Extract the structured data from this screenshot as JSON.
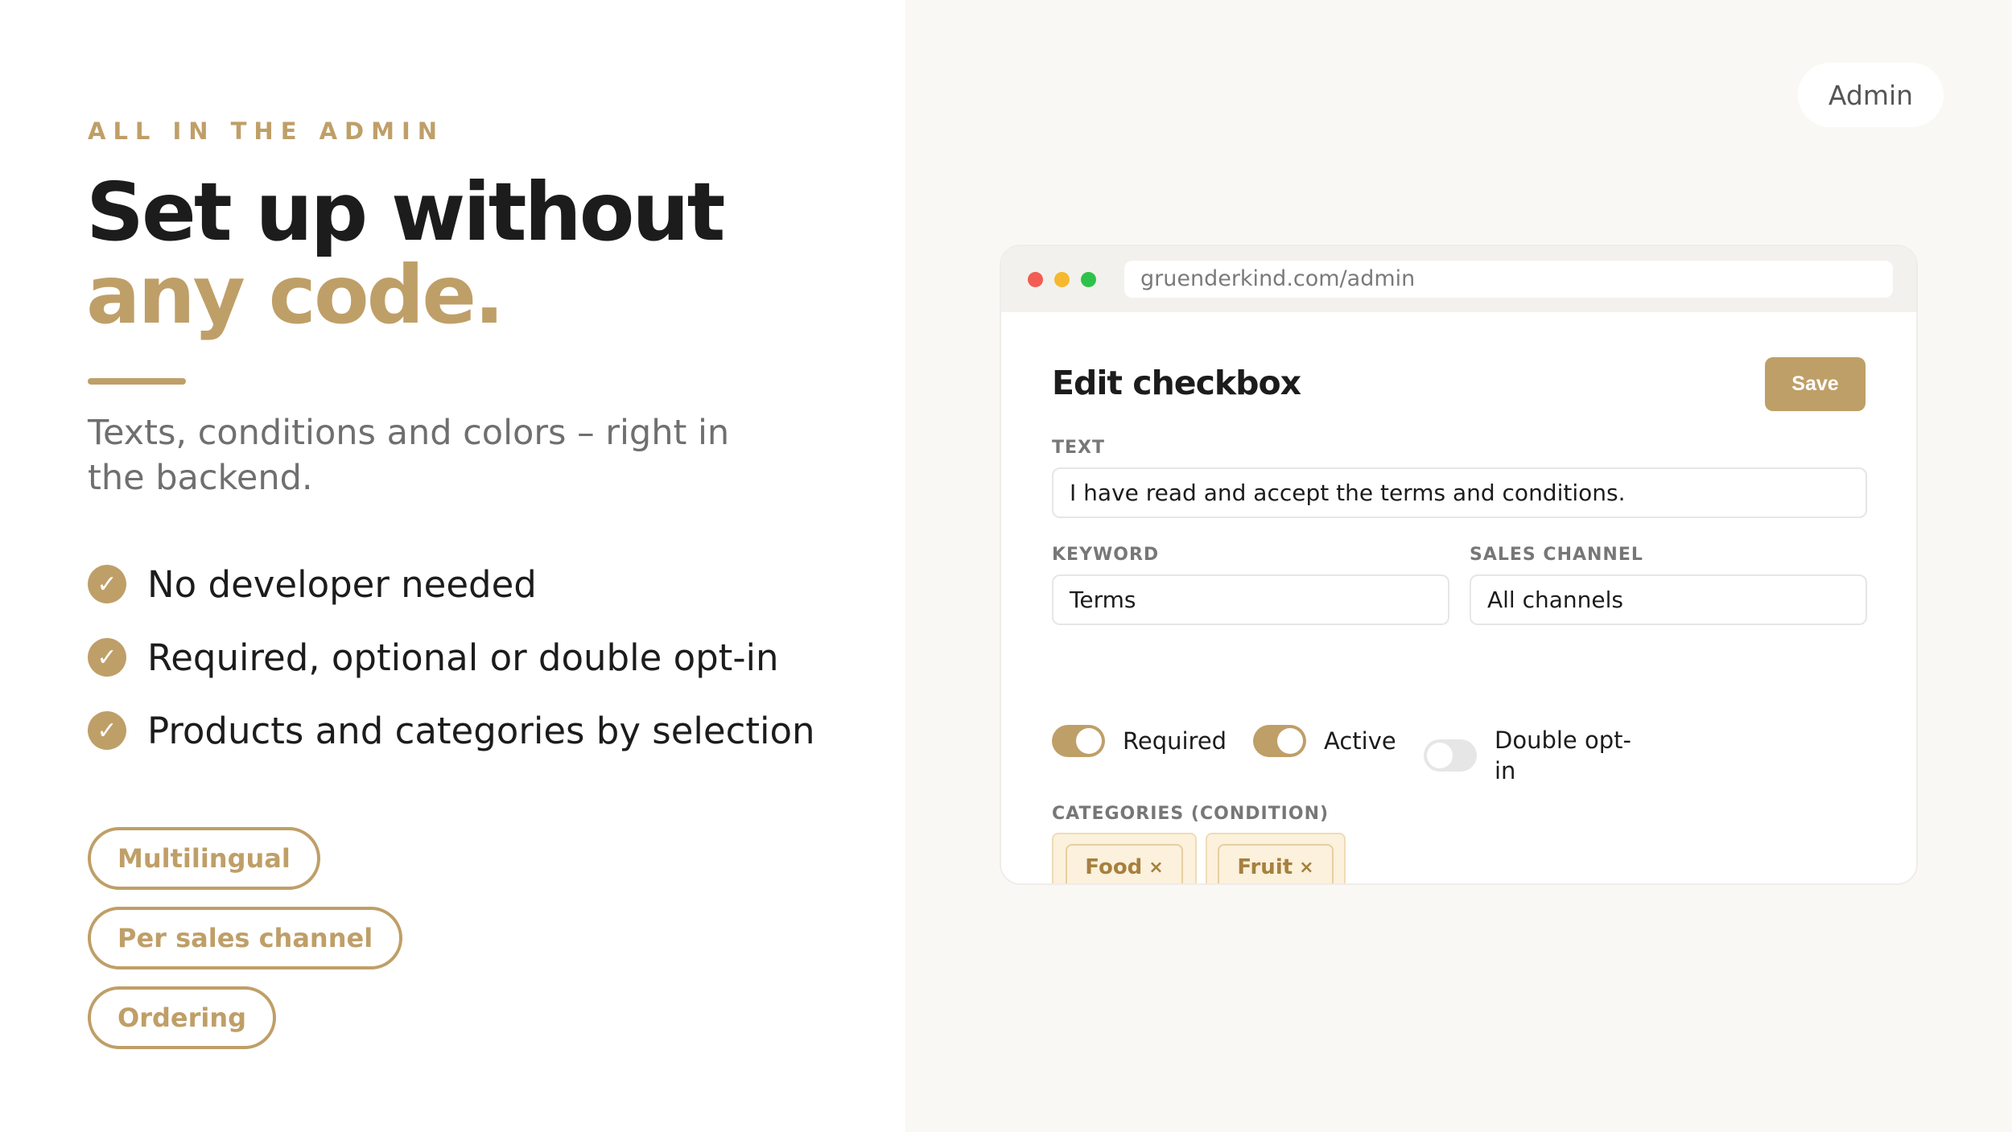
{
  "hero": {
    "eyebrow": "ALL IN THE ADMIN",
    "headline_line1": "Set up without",
    "headline_line2": "any code.",
    "lead": "Texts, conditions and colors – right in the backend."
  },
  "features": [
    {
      "label": "No developer needed",
      "icon": "check-icon"
    },
    {
      "label": "Required, optional or double opt-in",
      "icon": "check-icon"
    },
    {
      "label": "Products and categories by selection",
      "icon": "check-icon"
    }
  ],
  "chips": [
    "Multilingual",
    "Per sales channel",
    "Ordering"
  ],
  "admin_pill": "Admin",
  "browser": {
    "url": "gruenderkind.com/admin",
    "panel_title": "Edit checkbox",
    "save_label": "Save",
    "text_label": "TEXT",
    "text_value": "I have read and accept the terms and conditions.",
    "keyword_label": "KEYWORD",
    "keyword_value": "Terms",
    "sales_channel_label": "SALES CHANNEL",
    "sales_channel_value": "All channels",
    "toggles": [
      {
        "label": "Required",
        "on": true
      },
      {
        "label": "Active",
        "on": true
      },
      {
        "label": "Double opt-in",
        "on": false
      }
    ],
    "categories_label": "CATEGORIES (CONDITION)",
    "categories": [
      {
        "label": "Food",
        "remove": "×"
      },
      {
        "label": "Fruit",
        "remove": "×"
      }
    ]
  },
  "colors": {
    "accent": "#bf9f68",
    "text": "#1c1c1c",
    "muted": "#6f6f6f",
    "right_bg": "#f9f8f5",
    "tag_bg": "#fbf1dc"
  }
}
